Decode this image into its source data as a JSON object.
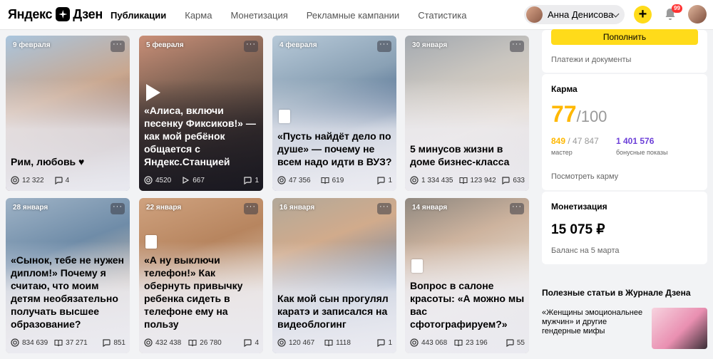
{
  "header": {
    "logo_text_1": "Яндекс",
    "logo_text_2": "Дзен",
    "nav": [
      "Публикации",
      "Карма",
      "Монетизация",
      "Рекламные кампании",
      "Статистика"
    ],
    "user_name": "Анна Денисова",
    "plus": "+",
    "notification_count": "99"
  },
  "cards": [
    {
      "date": "9 февраля",
      "title": "Рим, любовь ♥",
      "s1": "12 322",
      "s3": "4",
      "kind": "photo"
    },
    {
      "date": "5 февраля",
      "title": "«Алиса, включи песенку Фиксиков!» — как мой ребёнок общается с Яндекс.Станцией",
      "s1": "4520",
      "s2": "667",
      "s3": "1",
      "kind": "video"
    },
    {
      "date": "4 февраля",
      "title": "«Пусть найдёт дело по душе» — почему не всем надо идти в ВУЗ?",
      "s1": "47 356",
      "s2": "619",
      "s3": "1",
      "kind": "article"
    },
    {
      "date": "30 января",
      "title": "5 минусов жизни в доме бизнес-класса",
      "s1": "1 334 435",
      "s2": "123 942",
      "s3": "633",
      "kind": "article"
    },
    {
      "date": "28 января",
      "title": "«Сынок, тебе не нужен диплом!» Почему я считаю, что моим детям необязательно получать высшее образование?",
      "s1": "834 639",
      "s2": "37 271",
      "s3": "851",
      "kind": "article"
    },
    {
      "date": "22 января",
      "title": "«А ну выключи телефон!» Как обернуть привычку ребенка сидеть в телефоне ему на пользу",
      "s1": "432 438",
      "s2": "26 780",
      "s3": "4",
      "kind": "article"
    },
    {
      "date": "16 января",
      "title": "Как мой сын прогулял каратэ и записался на видеоблогинг",
      "s1": "120 467",
      "s2": "1118",
      "s3": "1",
      "kind": "article"
    },
    {
      "date": "14 января",
      "title": "Вопрос в салоне красоты: «А можно мы вас сфотографируем?»",
      "s1": "443 068",
      "s2": "23 196",
      "s3": "55",
      "kind": "article"
    }
  ],
  "sidebar": {
    "topup_label": "Пополнить",
    "payments_link": "Платежи и документы",
    "karma_title": "Карма",
    "karma_value": "77",
    "karma_max": "/100",
    "karma_progress": "849",
    "karma_progress_total": " / 47 847",
    "karma_level": "мастер",
    "bonus_shows": "1 401 576",
    "bonus_label": "бонусные показы",
    "karma_link": "Посмотреть карму",
    "money_title": "Монетизация",
    "money_value": "15 075 ₽",
    "money_sub": "Баланс на 5 марта",
    "journal_title": "Полезные статьи в Журнале Дзена",
    "journal_article": "«Женщины эмоциональнее мужчин» и другие гендерные мифы"
  },
  "colors": {
    "accent_yellow": "#ffdb1a",
    "karma_orange": "#ffb800",
    "bonus_purple": "#6c3fd8"
  }
}
